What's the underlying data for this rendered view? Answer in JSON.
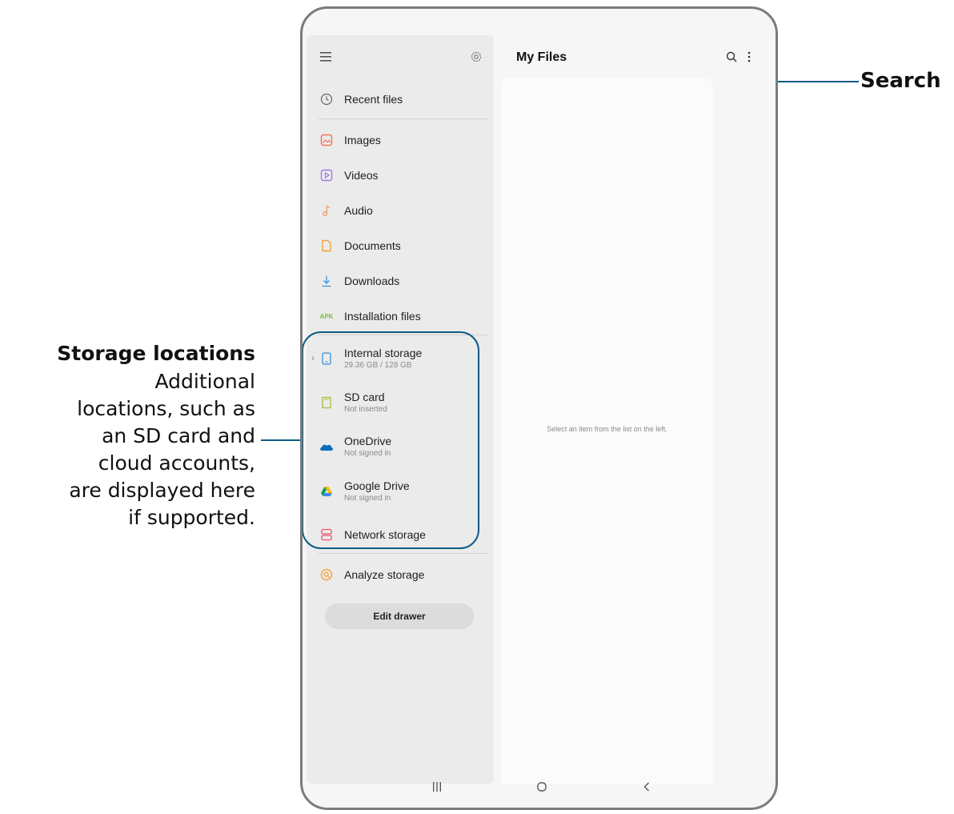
{
  "app": {
    "title": "My Files",
    "empty_message": "Select an item from the list on the left."
  },
  "drawer": {
    "menu_icon": "hamburger-menu-icon",
    "settings_icon": "gear-icon",
    "items": [
      {
        "label": "Recent files",
        "icon": "clock-icon"
      },
      {
        "label": "Images",
        "icon": "image-icon"
      },
      {
        "label": "Videos",
        "icon": "video-icon"
      },
      {
        "label": "Audio",
        "icon": "music-note-icon"
      },
      {
        "label": "Documents",
        "icon": "document-icon"
      },
      {
        "label": "Downloads",
        "icon": "download-icon"
      },
      {
        "label": "Installation files",
        "icon": "apk-icon",
        "icon_text": "APK"
      }
    ],
    "storage": [
      {
        "label": "Internal storage",
        "sub": "29.36 GB / 128 GB",
        "icon": "phone-icon"
      },
      {
        "label": "SD card",
        "sub": "Not inserted",
        "icon": "sd-card-icon"
      },
      {
        "label": "OneDrive",
        "sub": "Not signed in",
        "icon": "onedrive-icon"
      },
      {
        "label": "Google Drive",
        "sub": "Not signed in",
        "icon": "google-drive-icon"
      },
      {
        "label": "Network storage",
        "icon": "network-storage-icon"
      }
    ],
    "analyze": {
      "label": "Analyze storage",
      "icon": "analyze-icon"
    },
    "edit_button": "Edit drawer"
  },
  "annotations": {
    "search": "Search",
    "storage_title": "Storage locations",
    "storage_desc": [
      "Additional",
      "locations, such as",
      "an SD card and",
      "cloud accounts,",
      "are displayed here",
      "if supported."
    ]
  },
  "colors": {
    "accent_line": "#0e5b86",
    "images_icon": "#f0735d",
    "videos_icon": "#a07ae0",
    "audio_icon": "#f29b6b",
    "documents_icon": "#f2a23a",
    "downloads_icon": "#3b8fd9",
    "apk_icon": "#7ac142",
    "phone_icon": "#3a8ddb",
    "sdcard_icon": "#9fbf3a",
    "onedrive_icon": "#0f6cbd",
    "network_icon": "#e8546a",
    "analyze_icon": "#f2a23a"
  }
}
